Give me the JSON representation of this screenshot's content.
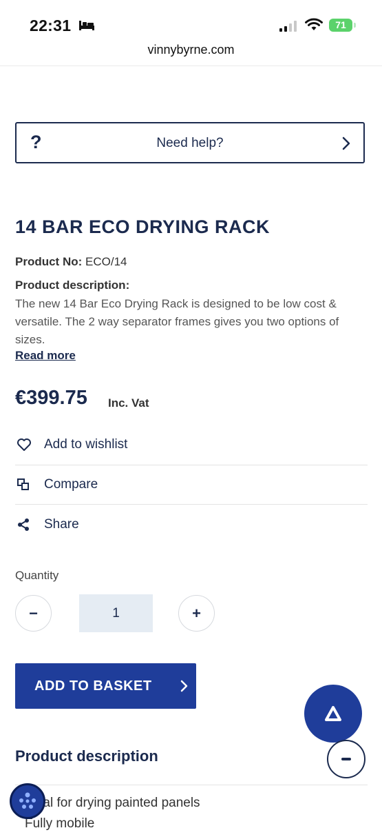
{
  "status_bar": {
    "time": "22:31",
    "battery": "71"
  },
  "browser": {
    "url": "vinnybyrne.com"
  },
  "help": {
    "icon_text": "?",
    "label": "Need help?"
  },
  "product": {
    "title": "14 BAR ECO DRYING RACK",
    "number_label": "Product No:",
    "number_value": "ECO/14",
    "description_label": "Product description:",
    "description": "The new 14 Bar Eco Drying Rack is designed to be low cost & versatile. The 2 way separator frames gives you two options of sizes.",
    "read_more": "Read more",
    "price": "€399.75",
    "vat_label": "Inc. Vat"
  },
  "actions": {
    "wishlist": "Add to wishlist",
    "compare": "Compare",
    "share": "Share"
  },
  "quantity": {
    "label": "Quantity",
    "value": "1",
    "minus": "−",
    "plus": "+"
  },
  "basket": {
    "label": "ADD TO BASKET"
  },
  "details": {
    "title": "Product description",
    "features": [
      "Ideal for drying painted panels",
      "Fully mobile"
    ]
  },
  "colors": {
    "primary": "#1f3d9a",
    "text": "#1b2a4e",
    "qty_bg": "#e5ecf3"
  }
}
